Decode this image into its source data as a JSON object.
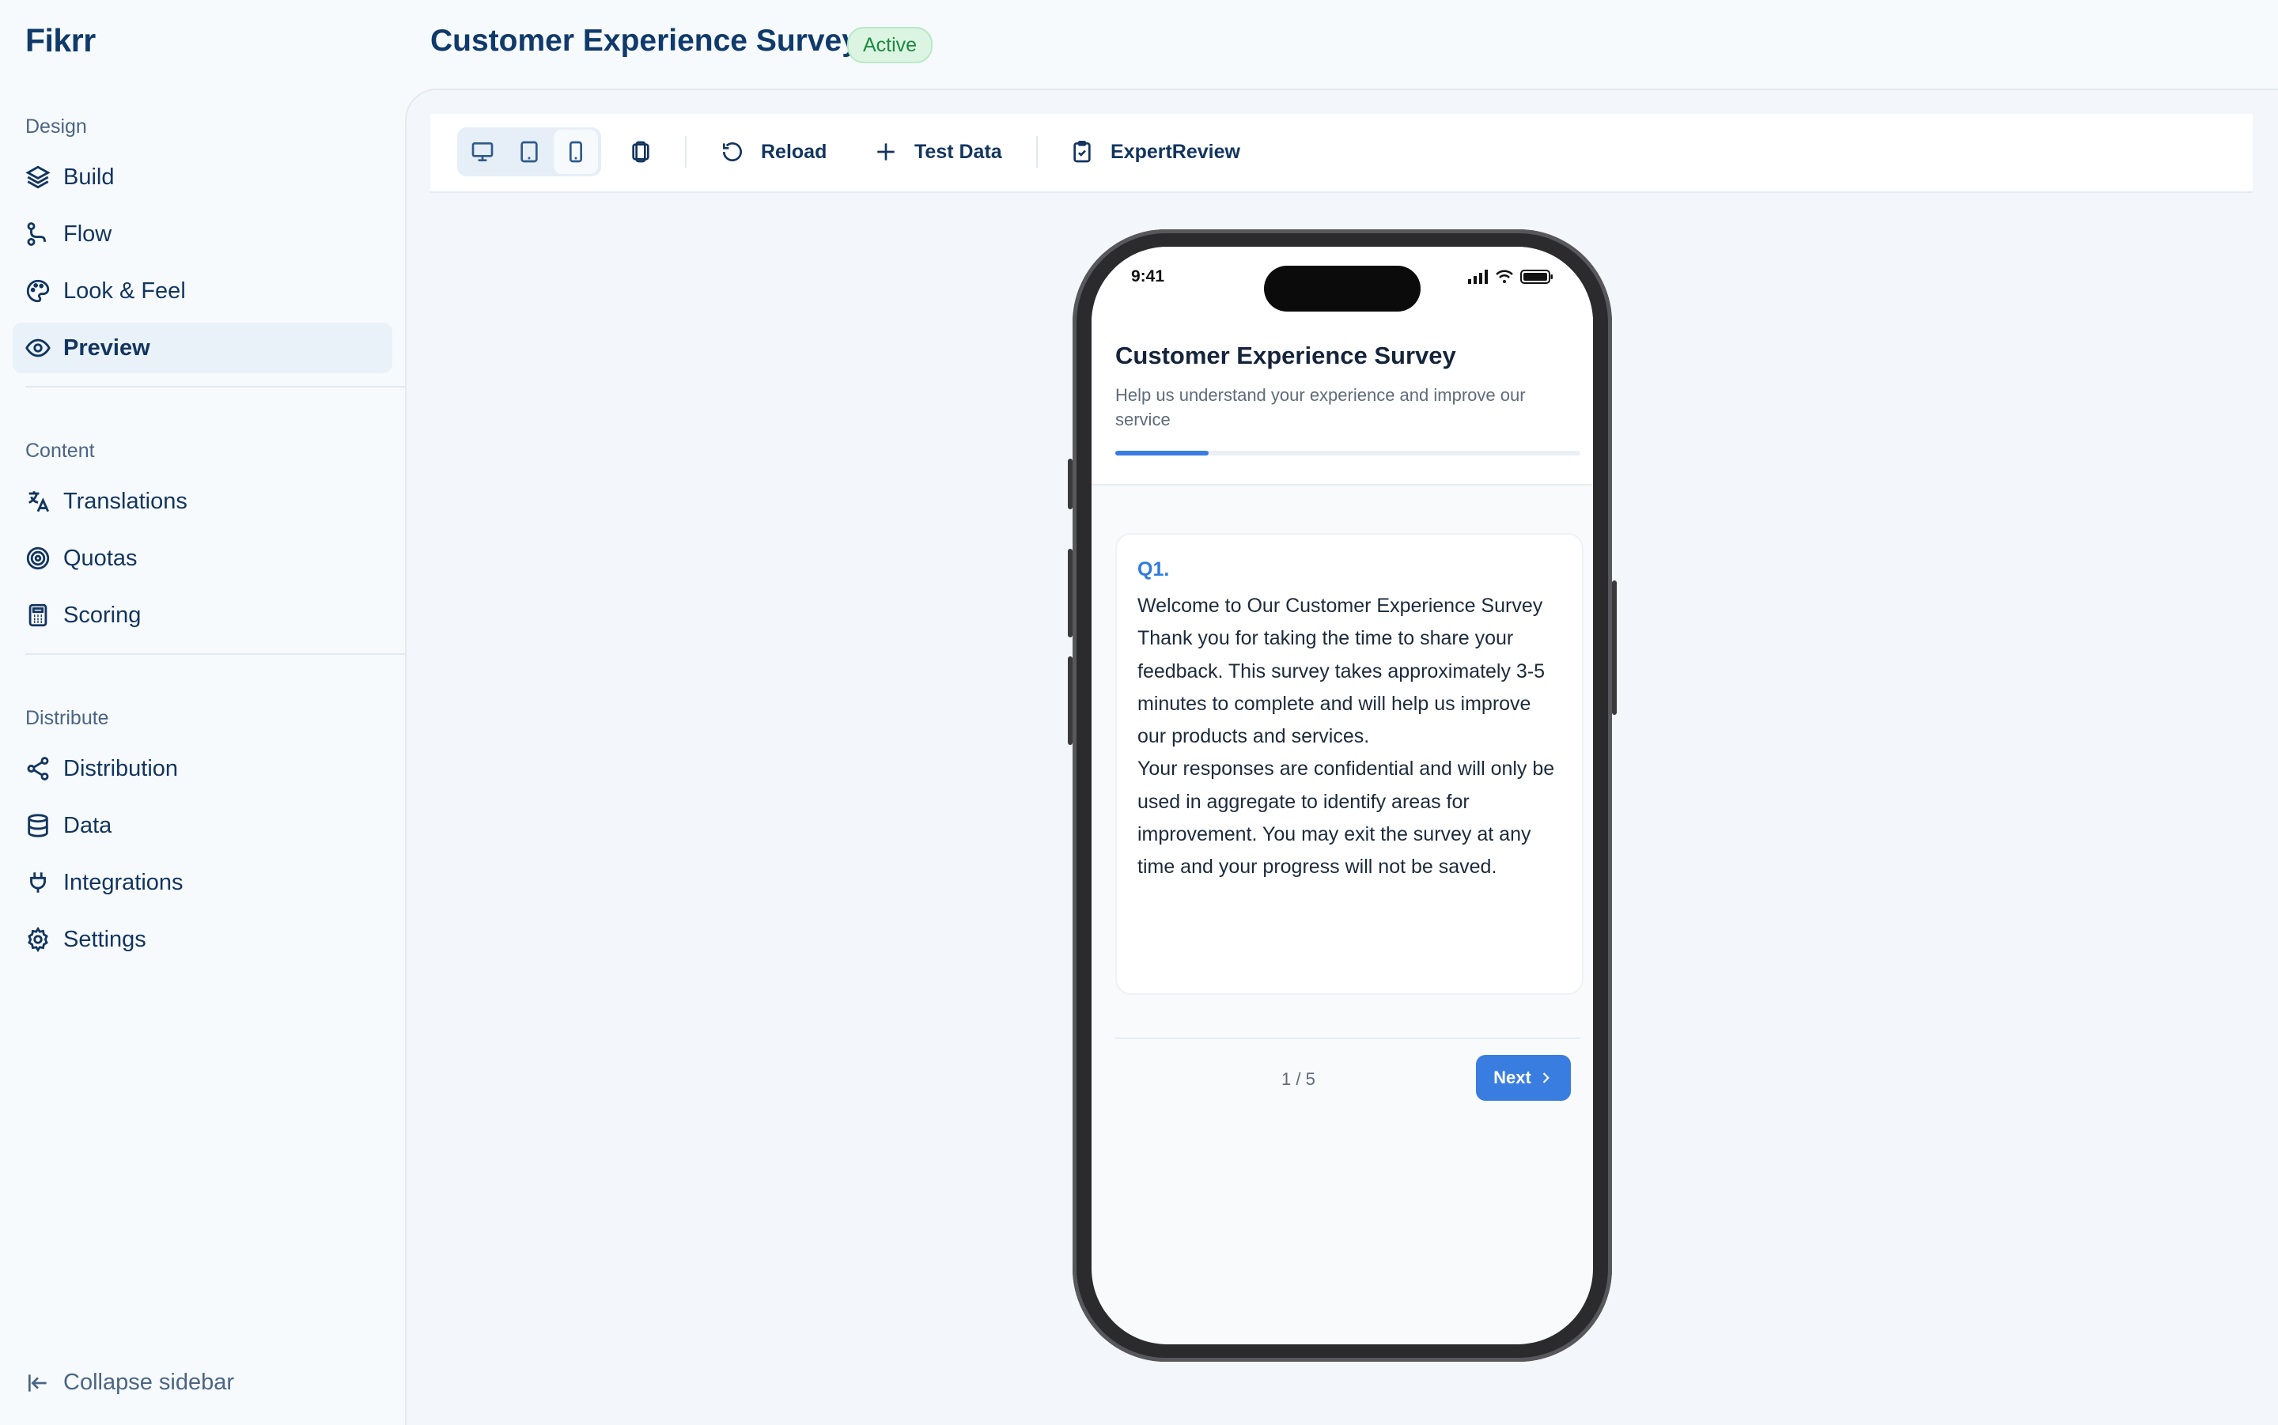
{
  "app": {
    "name": "Fikrr"
  },
  "header": {
    "title": "Customer Experience Survey",
    "status": "Active"
  },
  "sidebar": {
    "sections": [
      {
        "label": "Design",
        "items": [
          {
            "label": "Build",
            "icon": "layers-icon"
          },
          {
            "label": "Flow",
            "icon": "route-icon"
          },
          {
            "label": "Look & Feel",
            "icon": "palette-icon"
          },
          {
            "label": "Preview",
            "icon": "eye-icon",
            "active": true
          }
        ]
      },
      {
        "label": "Content",
        "items": [
          {
            "label": "Translations",
            "icon": "translate-icon"
          },
          {
            "label": "Quotas",
            "icon": "target-icon"
          },
          {
            "label": "Scoring",
            "icon": "calculator-icon"
          }
        ]
      },
      {
        "label": "Distribute",
        "items": [
          {
            "label": "Distribution",
            "icon": "share-icon"
          },
          {
            "label": "Data",
            "icon": "database-icon"
          },
          {
            "label": "Integrations",
            "icon": "plug-icon"
          },
          {
            "label": "Settings",
            "icon": "gear-icon"
          }
        ]
      }
    ],
    "collapse_label": "Collapse sidebar"
  },
  "toolbar": {
    "devices": [
      "desktop",
      "tablet",
      "mobile"
    ],
    "selected_device": "mobile",
    "reload_label": "Reload",
    "test_data_label": "Test Data",
    "expert_review_label": "ExpertReview"
  },
  "preview": {
    "status_time": "9:41",
    "survey_title": "Customer Experience Survey",
    "survey_subtitle": "Help us understand your experience and improve our service",
    "progress": 0.2,
    "question": {
      "number": "Q1.",
      "title": "Welcome to Our Customer Experience Survey",
      "paragraph1": "Thank you for taking the time to share your feedback. This survey takes approximately 3-5 minutes to complete and will help us improve our products and services.",
      "paragraph2": "Your responses are confidential and will only be used in aggregate to identify areas for improvement. You may exit the survey at any time and your progress will not be saved."
    },
    "page_indicator": "1 / 5",
    "next_label": "Next"
  },
  "colors": {
    "accent": "#3a7de0",
    "brand": "#0f3a6b",
    "active_badge_bg": "#dcf5e3",
    "active_badge_text": "#1c8a3e"
  }
}
